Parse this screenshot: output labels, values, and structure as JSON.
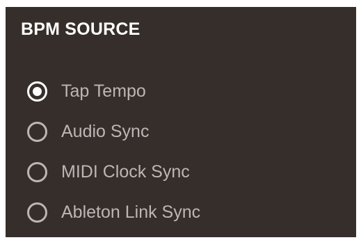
{
  "panel": {
    "title": "BPM SOURCE",
    "options": [
      {
        "label": "Tap Tempo",
        "selected": true
      },
      {
        "label": "Audio Sync",
        "selected": false
      },
      {
        "label": "MIDI Clock Sync",
        "selected": false
      },
      {
        "label": "Ableton Link Sync",
        "selected": false
      }
    ]
  },
  "colors": {
    "panel_background": "#352e2b",
    "title_text": "#ffffff",
    "option_text": "#bcb7b4",
    "radio_selected": "#ffffff",
    "radio_unselected": "#bcb7b4"
  }
}
